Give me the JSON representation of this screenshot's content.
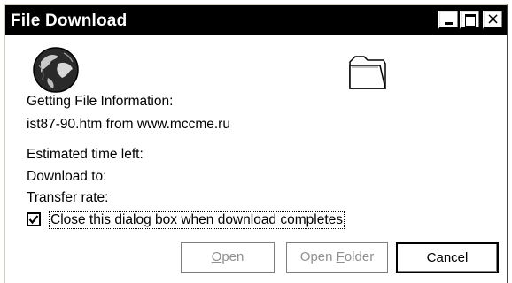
{
  "window": {
    "title": "File Download",
    "controls": {
      "minimize": "_",
      "maximize": "□",
      "close": "×"
    }
  },
  "icons": {
    "globe": "globe-icon",
    "folder": "folder-icon"
  },
  "status": {
    "heading": "Getting File Information:",
    "file_line": "ist87-90.htm from www.mccme.ru",
    "time_left_label": "Estimated time left:",
    "download_to_label": "Download to:",
    "transfer_rate_label": "Transfer rate:"
  },
  "options": {
    "close_when_done_label": "Close this dialog box when download completes",
    "close_when_done_checked": true
  },
  "buttons": {
    "open_prefix": "",
    "open_underlined": "O",
    "open_rest": "pen",
    "folder_prefix": "Open ",
    "folder_underlined": "F",
    "folder_rest": "older",
    "cancel": "Cancel"
  }
}
